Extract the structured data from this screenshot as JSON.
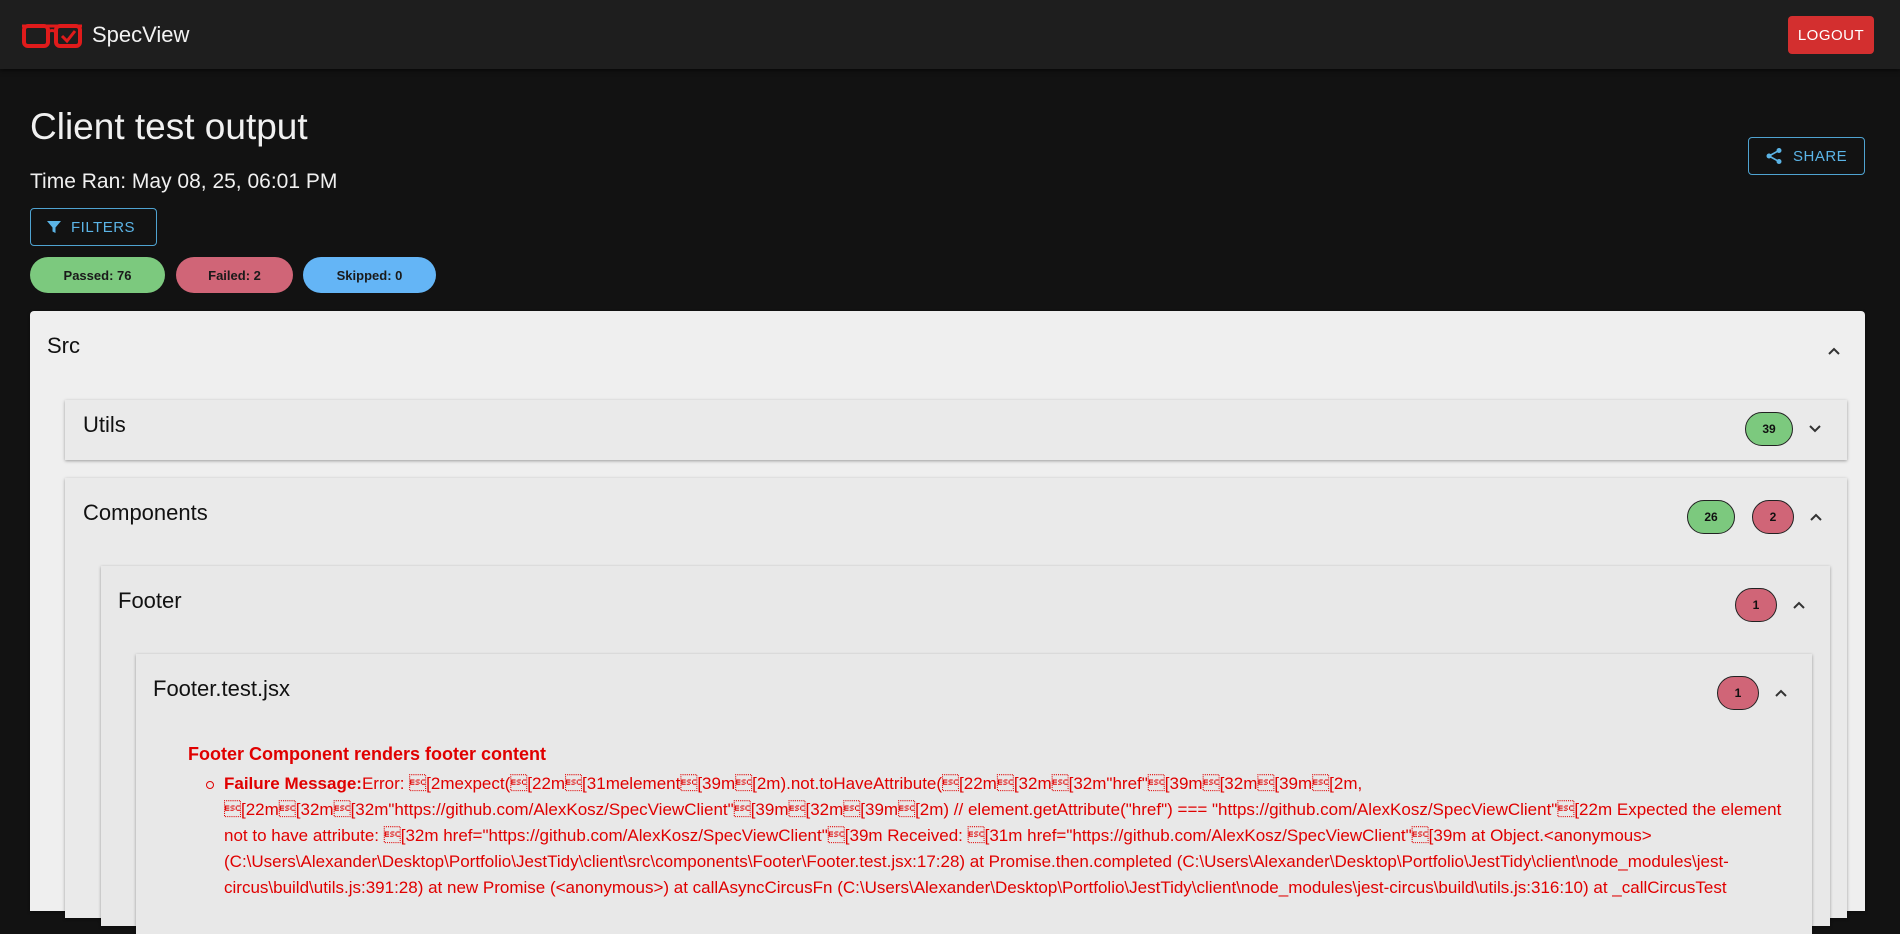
{
  "app": {
    "brand": "SpecView",
    "logout_label": "LOGOUT"
  },
  "header": {
    "title": "Client test output",
    "time_ran": "Time Ran: May 08, 25, 06:01 PM",
    "filters_label": "FILTERS",
    "share_label": "SHARE"
  },
  "summary": {
    "passed": "Passed: 76",
    "failed": "Failed: 2",
    "skipped": "Skipped: 0"
  },
  "tree": {
    "src": {
      "label": "Src"
    },
    "utils": {
      "label": "Utils",
      "passed": "39"
    },
    "components": {
      "label": "Components",
      "passed": "26",
      "failed": "2"
    },
    "footer": {
      "label": "Footer",
      "failed": "1"
    },
    "footer_test": {
      "label": "Footer.test.jsx",
      "failed": "1"
    }
  },
  "failure": {
    "test_name": "Footer Component renders footer content",
    "message_label": "Failure Message:",
    "message": "Error: \u001b[2mexpect(\u001b[22m\u001b[31melement\u001b[39m\u001b[2m).not.toHaveAttribute(\u001b[22m\u001b[32m\u001b[32m\"href\"\u001b[39m\u001b[32m\u001b[39m\u001b[2m, \u001b[22m\u001b[32m\u001b[32m\"https://github.com/AlexKosz/SpecViewClient\"\u001b[39m\u001b[32m\u001b[39m\u001b[2m) // element.getAttribute(\"href\") === \"https://github.com/AlexKosz/SpecViewClient\"\u001b[22m Expected the element not to have attribute: \u001b[32m href=\"https://github.com/AlexKosz/SpecViewClient\"\u001b[39m Received: \u001b[31m href=\"https://github.com/AlexKosz/SpecViewClient\"\u001b[39m at Object.<anonymous> (C:\\Users\\Alexander\\Desktop\\Portfolio\\JestTidy\\client\\src\\components\\Footer\\Footer.test.jsx:17:28) at Promise.then.completed (C:\\Users\\Alexander\\Desktop\\Portfolio\\JestTidy\\client\\node_modules\\jest-circus\\build\\utils.js:391:28) at new Promise (<anonymous>) at callAsyncCircusFn (C:\\Users\\Alexander\\Desktop\\Portfolio\\JestTidy\\client\\node_modules\\jest-circus\\build\\utils.js:316:10) at _callCircusTest"
  },
  "colors": {
    "background": "#121212",
    "appbar": "#1e1e1e",
    "logout": "#d32f2f",
    "accent": "#5bb4e6",
    "passed": "#7cc97e",
    "failed": "#d06577",
    "skipped": "#64b5f6",
    "error_text": "#e00000"
  },
  "icons": {
    "logo": "glasses-check-icon",
    "filters": "filter-icon",
    "share": "share-icon",
    "expand": "chevron-down-icon",
    "collapse": "chevron-up-icon"
  }
}
